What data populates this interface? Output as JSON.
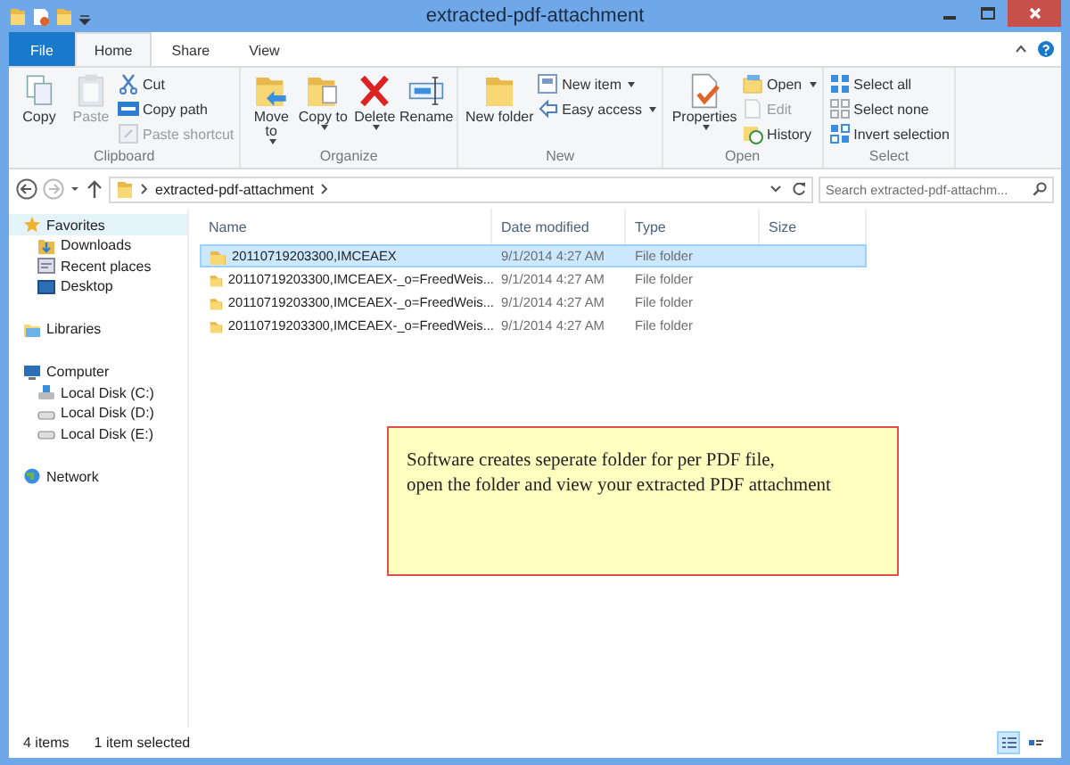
{
  "window": {
    "title": "extracted-pdf-attachment"
  },
  "tabs": [
    {
      "label": "File",
      "kind": "file",
      "selected": false
    },
    {
      "label": "Home",
      "kind": "tab",
      "selected": true
    },
    {
      "label": "Share",
      "kind": "tab",
      "selected": false
    },
    {
      "label": "View",
      "kind": "tab",
      "selected": false
    }
  ],
  "ribbon": [
    {
      "label": "Clipboard",
      "large": [
        {
          "label": "Copy",
          "disabled": false,
          "dropdown": false
        },
        {
          "label": "Paste",
          "disabled": true,
          "dropdown": false
        }
      ],
      "small": [
        {
          "label": "Cut",
          "disabled": false,
          "dropdown": false
        },
        {
          "label": "Copy path",
          "disabled": false,
          "dropdown": false
        },
        {
          "label": "Paste shortcut",
          "disabled": true,
          "dropdown": false
        }
      ]
    },
    {
      "label": "Organize",
      "large": [
        {
          "label": "Move to",
          "disabled": false,
          "dropdown": true
        },
        {
          "label": "Copy to",
          "disabled": false,
          "dropdown": true
        },
        {
          "label": "Delete",
          "disabled": false,
          "dropdown": true
        },
        {
          "label": "Rename",
          "disabled": false,
          "dropdown": false
        }
      ]
    },
    {
      "label": "New",
      "large": [
        {
          "label": "New folder",
          "disabled": false,
          "dropdown": false
        }
      ],
      "small": [
        {
          "label": "New item",
          "disabled": false,
          "dropdown": true
        },
        {
          "label": "Easy access",
          "disabled": false,
          "dropdown": true
        }
      ]
    },
    {
      "label": "Open",
      "large": [
        {
          "label": "Properties",
          "disabled": false,
          "dropdown": true
        }
      ],
      "small": [
        {
          "label": "Open",
          "disabled": false,
          "dropdown": true
        },
        {
          "label": "Edit",
          "disabled": true,
          "dropdown": false
        },
        {
          "label": "History",
          "disabled": false,
          "dropdown": false
        }
      ]
    },
    {
      "label": "Select",
      "small": [
        {
          "label": "Select all",
          "disabled": false,
          "dropdown": false
        },
        {
          "label": "Select none",
          "disabled": false,
          "dropdown": false
        },
        {
          "label": "Invert selection",
          "disabled": false,
          "dropdown": false
        }
      ]
    }
  ],
  "address": {
    "path": [
      "extracted-pdf-attachment"
    ],
    "search_placeholder": "Search extracted-pdf-attachm..."
  },
  "sidebar": [
    {
      "label": "Favorites",
      "selected": true,
      "children": [
        {
          "label": "Downloads",
          "selected": false
        },
        {
          "label": "Recent places",
          "selected": false
        },
        {
          "label": "Desktop",
          "selected": false
        }
      ]
    },
    {
      "label": "Libraries",
      "selected": false
    },
    {
      "label": "Computer",
      "selected": false,
      "children": [
        {
          "label": "Local Disk (C:)",
          "selected": false
        },
        {
          "label": "Local Disk (D:)",
          "selected": false
        },
        {
          "label": "Local Disk (E:)",
          "selected": false
        }
      ]
    },
    {
      "label": "Network",
      "selected": false
    }
  ],
  "columns": [
    "Name",
    "Date modified",
    "Type",
    "Size"
  ],
  "files": [
    {
      "name": "20110719203300,IMCEAEX",
      "date": "9/1/2014 4:27 AM",
      "type": "File folder",
      "selected": true
    },
    {
      "name": "20110719203300,IMCEAEX-_o=FreedWeis...",
      "date": "9/1/2014 4:27 AM",
      "type": "File folder",
      "selected": false
    },
    {
      "name": "20110719203300,IMCEAEX-_o=FreedWeis...",
      "date": "9/1/2014 4:27 AM",
      "type": "File folder",
      "selected": false
    },
    {
      "name": "20110719203300,IMCEAEX-_o=FreedWeis...",
      "date": "9/1/2014 4:27 AM",
      "type": "File folder",
      "selected": false
    }
  ],
  "callout": "Software creates seperate folder for per PDF file,\nopen the folder and view your extracted PDF attachment",
  "status_bar": {
    "count": "4 items",
    "selection": "1 item selected",
    "views": [
      {
        "kind": "details",
        "selected": true
      },
      {
        "kind": "tiles",
        "selected": false
      }
    ]
  }
}
